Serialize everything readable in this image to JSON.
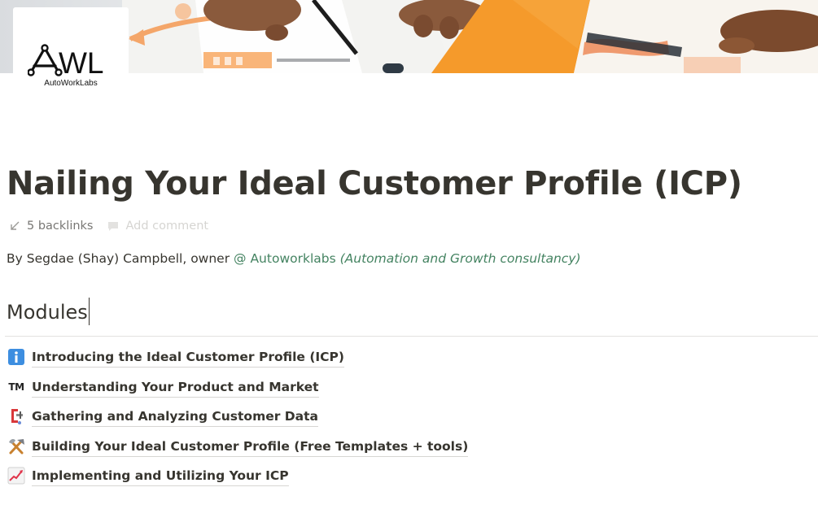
{
  "cover": {
    "description_icon": "cover-photo"
  },
  "logo": {
    "mark_text": "WL",
    "caption": "AutoWorkLabs"
  },
  "page": {
    "title": "Nailing Your Ideal Customer Profile (ICP)",
    "backlinks_label": "5 backlinks",
    "add_comment_label": "Add comment"
  },
  "byline": {
    "prefix": "By Segdae (Shay) Campbell, owner ",
    "mention": "@ Autoworklabs",
    "note": "(Automation and Growth consultancy)"
  },
  "modules": {
    "heading": "Modules",
    "items": [
      {
        "icon": "information-icon",
        "label": "Introducing the Ideal Customer Profile (ICP)"
      },
      {
        "icon": "trademark-icon",
        "label": "Understanding Your Product and Market"
      },
      {
        "icon": "clamp-icon",
        "label": "Gathering and Analyzing Customer Data"
      },
      {
        "icon": "hammer-and-pick-icon",
        "label": "Building Your Ideal Customer Profile (Free Templates + tools)"
      },
      {
        "icon": "chart-increasing-icon",
        "label": "Implementing and Utilizing Your ICP"
      }
    ]
  },
  "colors": {
    "text": "#37352f",
    "muted": "#787774",
    "mention_green": "#448361",
    "accent_orange": "#f5922b",
    "info_blue": "#3d8ee0"
  }
}
